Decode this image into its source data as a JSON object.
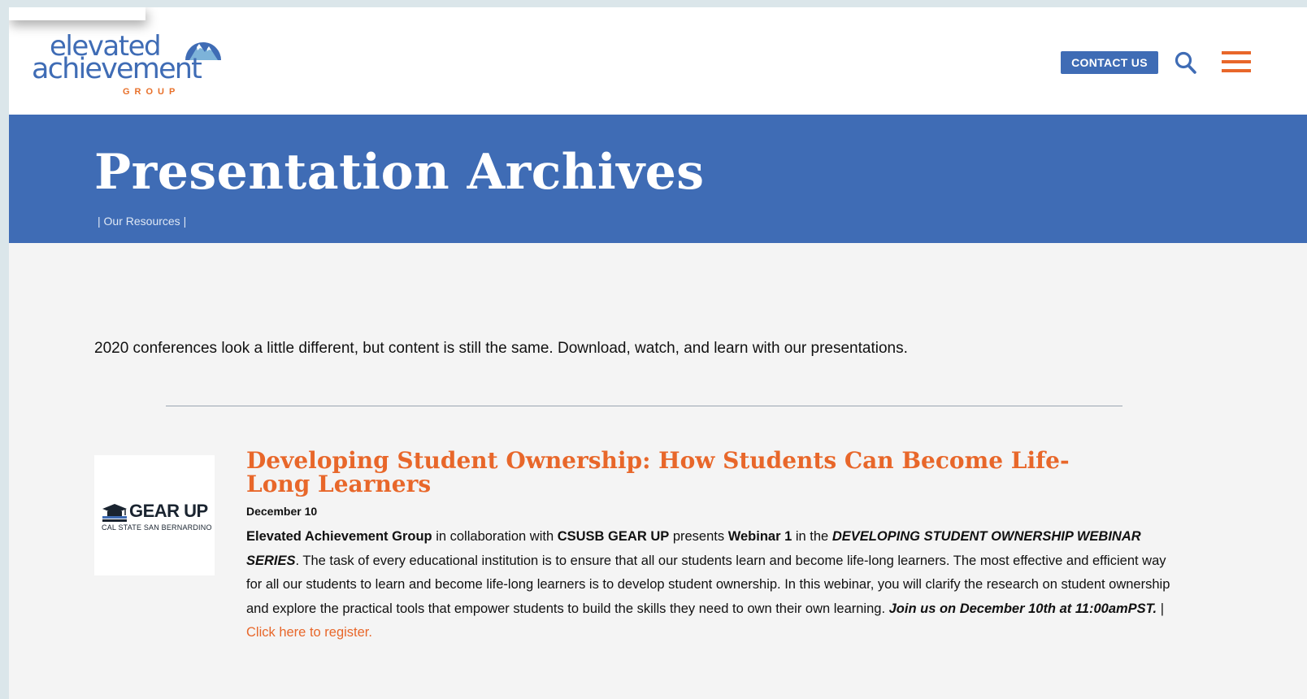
{
  "header": {
    "logo": {
      "line1": "elevated",
      "line2": "achievement",
      "line3": "GROUP"
    },
    "contact_label": "CONTACT US"
  },
  "banner": {
    "title": "Presentation Archives",
    "breadcrumb_sep_left": "|",
    "breadcrumb_link": "Our Resources",
    "breadcrumb_sep_right": "|"
  },
  "intro": "2020 conferences look a little different, but content is still the same. Download, watch, and learn with our presentations.",
  "posts": [
    {
      "thumb_title": "GEAR UP",
      "thumb_subtitle": "CAL STATE SAN BERNARDINO",
      "title": "Developing Student Ownership: How Students Can Become Life-Long Learners",
      "date": "December 10",
      "body": {
        "org": "Elevated Achievement Group",
        "t1": " in collaboration with ",
        "partner": "CSUSB GEAR UP",
        "t2": " presents ",
        "webinar": "Webinar 1",
        "t3": " in the ",
        "series": "DEVELOPING STUDENT OWNERSHIP WEBINAR SERIES",
        "t4": ". The task of every educational institution is to ensure that all our students learn and become life-long learners. The most effective and efficient way for all our students to learn and become life-long learners is to develop student ownership. In this webinar, you will clarify the research on student ownership and explore the practical tools that empower students to build the skills they need to own their own learning. ",
        "join": "Join us on December 10th at 11:00amPST.",
        "sep": " | ",
        "register": "Click here to register."
      }
    }
  ],
  "colors": {
    "brand_blue": "#3f6cb5",
    "accent_orange": "#e8672a",
    "page_bg": "#f4f4f4"
  },
  "icons": [
    "mountain-logo-icon",
    "search-icon",
    "hamburger-menu-icon",
    "graduation-cap-icon"
  ]
}
